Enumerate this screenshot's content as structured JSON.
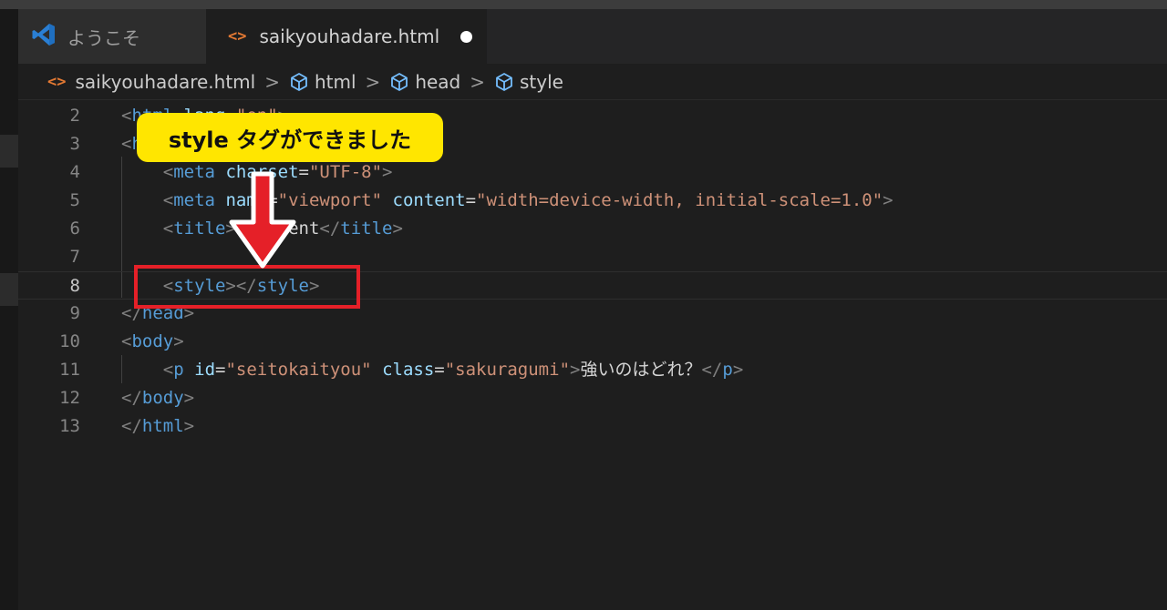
{
  "tabs": [
    {
      "label": "ようこそ",
      "icon": "vscode-logo-icon",
      "active": false
    },
    {
      "label": "saikyouhadare.html",
      "icon": "html-file-icon",
      "active": true,
      "modified": true
    }
  ],
  "breadcrumb": [
    {
      "label": "saikyouhadare.html",
      "icon": "html-file-icon"
    },
    {
      "label": "html",
      "icon": "element-cube-icon"
    },
    {
      "label": "head",
      "icon": "element-cube-icon"
    },
    {
      "label": "style",
      "icon": "element-cube-icon"
    }
  ],
  "lines": [
    {
      "n": "2",
      "current": false,
      "tokens": [
        [
          "b",
          "<"
        ],
        [
          "tag",
          "html"
        ],
        [
          "text",
          " "
        ],
        [
          "attr",
          "lang"
        ],
        [
          "text",
          "="
        ],
        [
          "str",
          "\"en\""
        ],
        [
          "b",
          ">"
        ]
      ]
    },
    {
      "n": "3",
      "current": false,
      "tokens": [
        [
          "b",
          "<"
        ],
        [
          "tag",
          "head"
        ],
        [
          "b",
          ">"
        ]
      ]
    },
    {
      "n": "4",
      "current": false,
      "tokens": [
        [
          "text",
          "    "
        ],
        [
          "b",
          "<"
        ],
        [
          "tag",
          "meta"
        ],
        [
          "text",
          " "
        ],
        [
          "attr",
          "charset"
        ],
        [
          "text",
          "="
        ],
        [
          "str",
          "\"UTF-8\""
        ],
        [
          "b",
          ">"
        ]
      ]
    },
    {
      "n": "5",
      "current": false,
      "tokens": [
        [
          "text",
          "    "
        ],
        [
          "b",
          "<"
        ],
        [
          "tag",
          "meta"
        ],
        [
          "text",
          " "
        ],
        [
          "attr",
          "name"
        ],
        [
          "text",
          "="
        ],
        [
          "str",
          "\"viewport\""
        ],
        [
          "text",
          " "
        ],
        [
          "attr",
          "content"
        ],
        [
          "text",
          "="
        ],
        [
          "str",
          "\"width=device-width, initial-scale=1.0\""
        ],
        [
          "b",
          ">"
        ]
      ]
    },
    {
      "n": "6",
      "current": false,
      "tokens": [
        [
          "text",
          "    "
        ],
        [
          "b",
          "<"
        ],
        [
          "tag",
          "title"
        ],
        [
          "b",
          ">"
        ],
        [
          "text",
          "Document"
        ],
        [
          "b",
          "</"
        ],
        [
          "tag",
          "title"
        ],
        [
          "b",
          ">"
        ]
      ]
    },
    {
      "n": "7",
      "current": false,
      "tokens": []
    },
    {
      "n": "8",
      "current": true,
      "tokens": [
        [
          "text",
          "    "
        ],
        [
          "b",
          "<"
        ],
        [
          "tag",
          "style"
        ],
        [
          "b",
          "></"
        ],
        [
          "tag",
          "style"
        ],
        [
          "b",
          ">"
        ]
      ]
    },
    {
      "n": "9",
      "current": false,
      "tokens": [
        [
          "b",
          "</"
        ],
        [
          "tag",
          "head"
        ],
        [
          "b",
          ">"
        ]
      ]
    },
    {
      "n": "10",
      "current": false,
      "tokens": [
        [
          "b",
          "<"
        ],
        [
          "tag",
          "body"
        ],
        [
          "b",
          ">"
        ]
      ]
    },
    {
      "n": "11",
      "current": false,
      "tokens": [
        [
          "text",
          "    "
        ],
        [
          "b",
          "<"
        ],
        [
          "tag",
          "p"
        ],
        [
          "text",
          " "
        ],
        [
          "attr",
          "id"
        ],
        [
          "text",
          "="
        ],
        [
          "str",
          "\"seitokaityou\""
        ],
        [
          "text",
          " "
        ],
        [
          "attr",
          "class"
        ],
        [
          "text",
          "="
        ],
        [
          "str",
          "\"sakuragumi\""
        ],
        [
          "b",
          ">"
        ],
        [
          "text",
          "強いのはどれ？"
        ],
        [
          "b",
          "</"
        ],
        [
          "tag",
          "p"
        ],
        [
          "b",
          ">"
        ]
      ]
    },
    {
      "n": "12",
      "current": false,
      "tokens": [
        [
          "b",
          "</"
        ],
        [
          "tag",
          "body"
        ],
        [
          "b",
          ">"
        ]
      ]
    },
    {
      "n": "13",
      "current": false,
      "tokens": [
        [
          "b",
          "</"
        ],
        [
          "tag",
          "html"
        ],
        [
          "b",
          ">"
        ]
      ]
    }
  ],
  "annotation": {
    "callout_text": "style タグができました"
  },
  "colors": {
    "accent_yellow": "#ffe600",
    "highlight_red": "#e52028",
    "tag_blue": "#569cd6",
    "attr_lightblue": "#9cdcfe",
    "string_orange": "#ce9178"
  }
}
